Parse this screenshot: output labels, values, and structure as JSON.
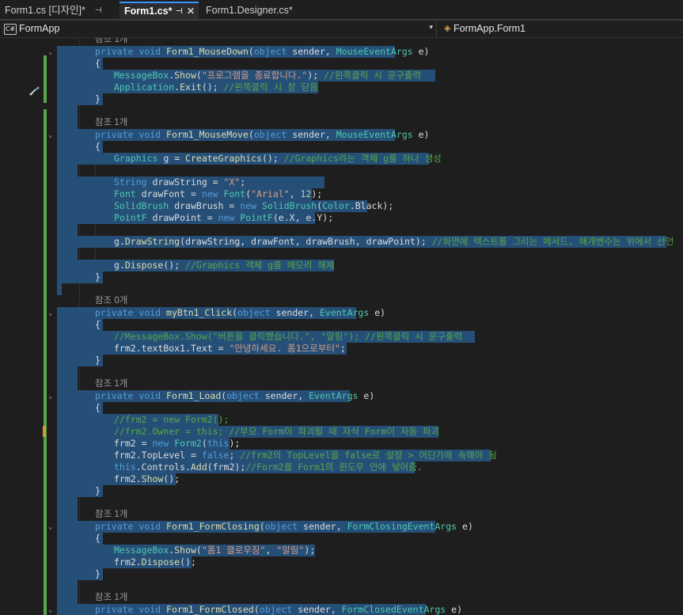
{
  "tabs": [
    {
      "label": "Form1.cs [디자인]*",
      "pinned": true,
      "active": false
    },
    {
      "label": "Form1.cs*",
      "pinned": true,
      "active": true
    },
    {
      "label": "Form1.Designer.cs*",
      "pinned": false,
      "active": false
    }
  ],
  "nav": {
    "project": "FormApp",
    "class": "FormApp.Form1",
    "project_icon_text": "C#"
  },
  "colors": {
    "keyword": "#569cd6",
    "type": "#4ec9b0",
    "method": "#dcdcaa",
    "string": "#d69d85",
    "comment": "#57a64a",
    "selection": "#264f78",
    "background": "#1e1e1e",
    "change_bar": "#57a64a"
  },
  "icons": {
    "gutter": "screwdriver-brush-icon",
    "fold": "chevron-down-icon",
    "close": "close-icon",
    "pin": "pin-icon"
  },
  "code": {
    "refs": [
      "참조 1개",
      "참조 1개",
      "참조 0개",
      "참조 1개",
      "참조 1개",
      "참조 1개"
    ],
    "lines": [
      "private void Form1_MouseDown(object sender, MouseEventArgs e)",
      "{",
      "MessageBox.Show(\"프로그램을 종료합니다.\"); //왼쪽클릭 시 문구출력",
      "Application.Exit(); //왼쪽클릭 시 창 닫음",
      "}",
      "private void Form1_MouseMove(object sender, MouseEventArgs e)",
      "{",
      "Graphics g = CreateGraphics(); //Graphics라는 객체 g를 하나 생성",
      "String drawString = \"X\";",
      "Font drawFont = new Font(\"Arial\", 12);",
      "SolidBrush drawBrush = new SolidBrush(Color.Black);",
      "PointF drawPoint = new PointF(e.X, e.Y);",
      "g.DrawString(drawString, drawFont, drawBrush, drawPoint); //화면에 텍스트를 그리는 메서드, 매개변수는 위에서 선언",
      "g.Dispose(); //Graphics 객체 g를 메모리 해제",
      "}",
      "private void myBtn1_Click(object sender, EventArgs e)",
      "{",
      "//MessageBox.Show(\"버튼을 클릭했습니다.\", \"알림\"); //왼쪽클릭 시 문구출력",
      "frm2.textBox1.Text = \"안녕하세요. 폼1으로부터\";",
      "}",
      "private void Form1_Load(object sender, EventArgs e)",
      "{",
      "//frm2 = new Form2();",
      "//frm2.Owner = this; //부모 Form이 파괴될 때 자식 Form이 자동 파괴",
      "frm2 = new Form2(this);",
      "frm2.TopLevel = false; //frm2의 TopLevel을 false로 설정 > 어딘가에 속해야 됨",
      "this.Controls.Add(frm2);//Form2를 Form1의 윈도우 안에 넣어줌.",
      "frm2.Show();",
      "}",
      "private void Form1_FormClosing(object sender, FormClosingEventArgs e)",
      "{",
      "MessageBox.Show(\"폼1 클로우징\", \"알림\");",
      "frm2.Dispose();",
      "}",
      "private void Form1_FormClosed(object sender, FormClosedEventArgs e)"
    ]
  }
}
